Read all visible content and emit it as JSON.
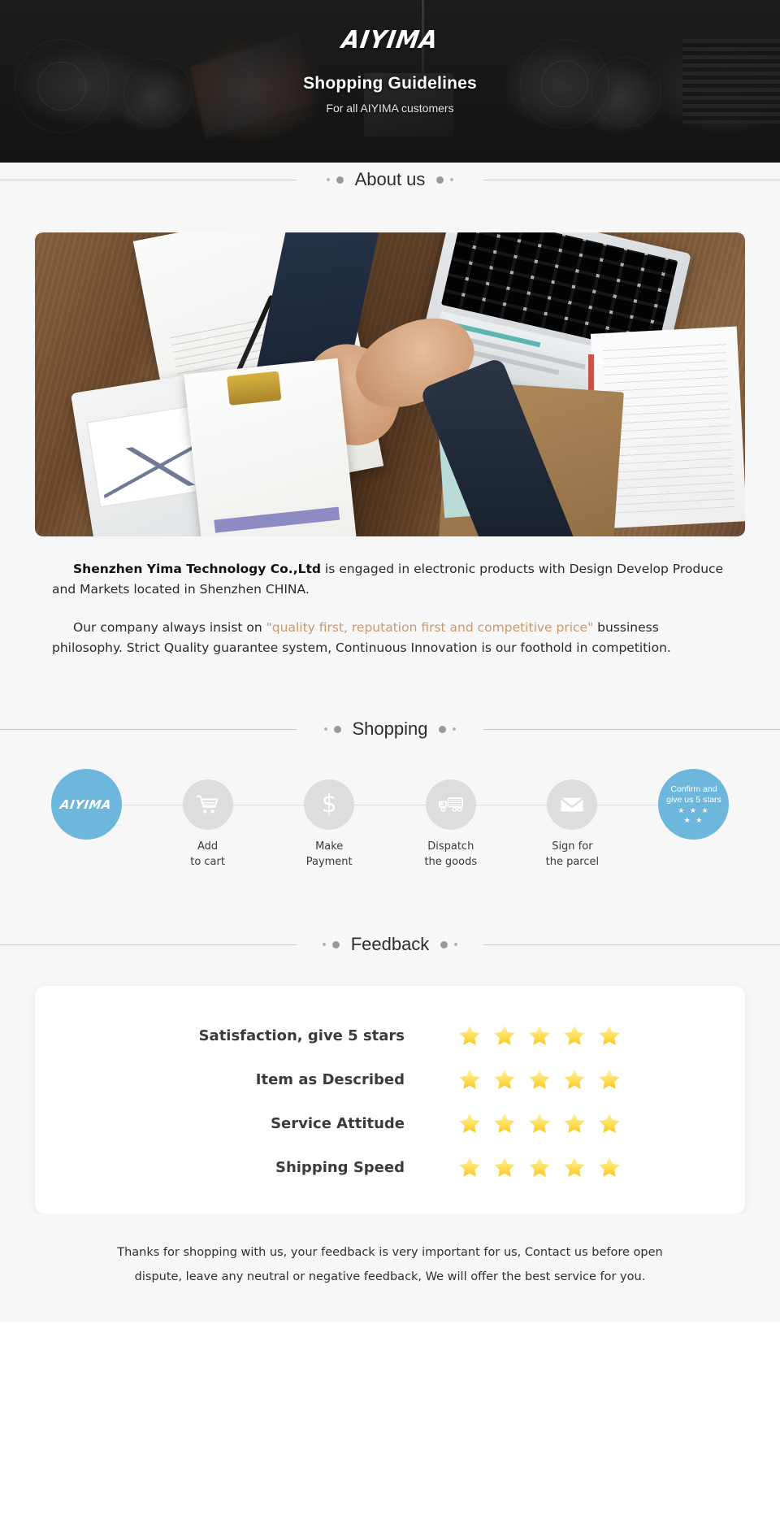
{
  "hero": {
    "brand": "AIYIMA",
    "title": "Shopping Guidelines",
    "subtitle": "For all AIYIMA customers"
  },
  "sections": {
    "about_title": "About us",
    "shopping_title": "Shopping",
    "feedback_title": "Feedback"
  },
  "about": {
    "paragraph1_company": "Shenzhen Yima Technology Co.,Ltd",
    "paragraph1_rest": " is engaged in electronic products with Design Develop Produce and Markets located in Shenzhen CHINA.",
    "paragraph2_pre": "Our company always insist on ",
    "paragraph2_quote": "\"quality first, reputation first and competitive price\"",
    "paragraph2_post": " bussiness philosophy. Strict Quality guarantee system, Continuous Innovation is our foothold in competition."
  },
  "shopping_steps": [
    {
      "icon": "aiyima-logo-icon",
      "logo": "AIYIMA",
      "label_line1": "",
      "label_line2": "",
      "type": "brand"
    },
    {
      "icon": "shopping-cart-icon",
      "label_line1": "Add",
      "label_line2": "to cart",
      "type": "gray"
    },
    {
      "icon": "dollar-sign-icon",
      "label_line1": "Make",
      "label_line2": "Payment",
      "type": "gray"
    },
    {
      "icon": "delivery-truck-icon",
      "label_line1": "Dispatch",
      "label_line2": "the goods",
      "type": "gray"
    },
    {
      "icon": "envelope-icon",
      "label_line1": "Sign for",
      "label_line2": "the parcel",
      "type": "gray"
    },
    {
      "icon": "five-stars-icon",
      "circle_line1": "Confirm and",
      "circle_line2": "give us 5 stars",
      "stars_top": "★ ★ ★",
      "stars_bottom": "★ ★",
      "label_line1": "",
      "label_line2": "",
      "type": "blue"
    }
  ],
  "feedback_rows": [
    {
      "label": "Satisfaction, give 5 stars",
      "stars": 5
    },
    {
      "label": "Item as Described",
      "stars": 5
    },
    {
      "label": "Service Attitude",
      "stars": 5
    },
    {
      "label": "Shipping Speed",
      "stars": 5
    }
  ],
  "footer": {
    "line1": "Thanks for shopping with us, your feedback is very important for us, Contact us before open",
    "line2": "dispute, leave any neutral or negative feedback, We will offer the best service for you."
  },
  "colors": {
    "accent_blue": "#6db6dc",
    "quote_tan": "#c79a6c",
    "star_yellow": "#ffd24d",
    "hero_bg": "#1b1b1b",
    "page_bg": "#f7f7f7"
  }
}
